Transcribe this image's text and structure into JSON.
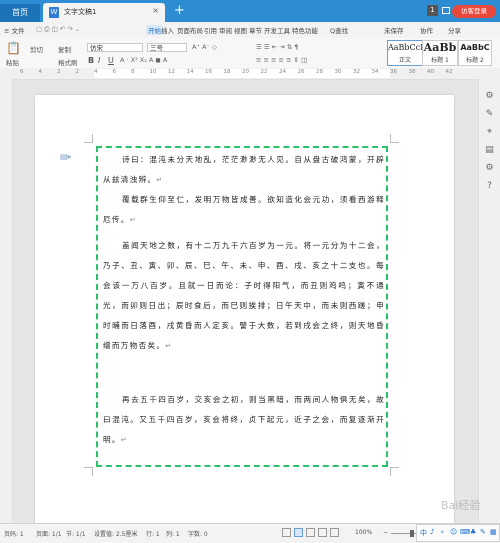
{
  "tabs": {
    "home": "首页",
    "doc_title": "文字文稿1",
    "close": "×",
    "new": "+"
  },
  "titlebar": {
    "badge": "1",
    "login": "访客登录"
  },
  "menu": {
    "file": "≡ 文件",
    "items": [
      "开始",
      "插入",
      "页面布局",
      "引用",
      "审阅",
      "视图",
      "章节",
      "开发工具",
      "特色功能"
    ],
    "search": "Q查找",
    "unsaved": "未保存",
    "collab": "协作",
    "share": "分享"
  },
  "ribbon": {
    "paste": "粘贴",
    "cut": "剪切",
    "copy": "复制",
    "format_painter": "格式刷",
    "font": "仿宋",
    "size": "三号",
    "bold": "B",
    "italic": "I",
    "underline": "U",
    "styles": [
      {
        "sample": "AaBbCcDd",
        "name": "正文"
      },
      {
        "sample": "AaBb",
        "name": "标题 1"
      },
      {
        "sample": "AaBbC",
        "name": "标题 2"
      }
    ]
  },
  "ruler": {
    "labels": [
      "6",
      "4",
      "2",
      "2",
      "4",
      "6",
      "8",
      "10",
      "12",
      "14",
      "16",
      "18",
      "20",
      "22",
      "24",
      "26",
      "28",
      "30",
      "32",
      "34",
      "36",
      "38",
      "40",
      "42"
    ]
  },
  "document": {
    "paragraphs": [
      "诗曰：混沌未分天地乱，茫茫渺渺无人见。自从盘古破鸿蒙，开辟从兹清浊辨。",
      "覆载群生仰至仁，发明万物皆成善。欲知造化会元功，须看西游释厄传。",
      "盖闻天地之数，有十二万九千六百岁为一元。将一元分为十二会，乃子、丑、寅、卯、辰、巳、午、未、申、酉、戌、亥之十二支也。每会该一万八百岁。且就一日而论：子时得阳气，而丑则鸡鸣；寅不通光，而卯则日出；辰时食后，而巳则挨排；日午天中，而未则西蹉；申时晡而日落酉，戌黄昏而人定亥。譬于大数，若到戌会之终，则天地昏缯而万物否矣。",
      "再去五千四百岁，交亥会之初，则当黑暗，而两间人物俱无矣，故曰混沌。又五千四百岁，亥会将终，贞下起元，近子之会，而复逐渐开明。"
    ],
    "para_mark": "↵"
  },
  "status": {
    "page": "页码: 1",
    "pages": "页面: 1/1",
    "section": "节: 1/1",
    "setting": "设置值: 2.5厘米",
    "row": "行: 1",
    "col": "列: 1",
    "words": "字数: 0",
    "zoom": "100%",
    "zoom_minus": "−",
    "zoom_plus": "+"
  },
  "ime": {
    "items": [
      "中",
      "♪",
      "∘",
      "☺",
      "⌨",
      "♣",
      "✎",
      "▦"
    ]
  },
  "watermark": "Bai经验"
}
